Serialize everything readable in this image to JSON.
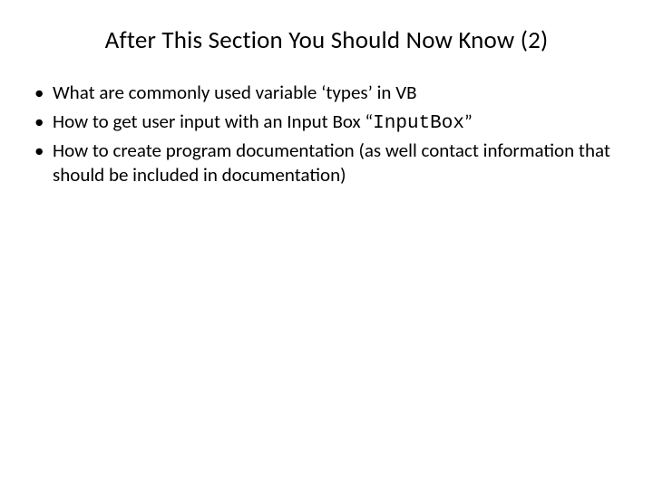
{
  "title": "After This Section You Should Now Know (2)",
  "bullets": [
    {
      "pre": "What are commonly used variable ‘types’ in VB",
      "code": "",
      "post": ""
    },
    {
      "pre": "How to get user input with an Input Box “",
      "code": "InputBox",
      "post": "”"
    },
    {
      "pre": "How to create program documentation (as well contact information that should be included in documentation)",
      "code": "",
      "post": ""
    }
  ]
}
